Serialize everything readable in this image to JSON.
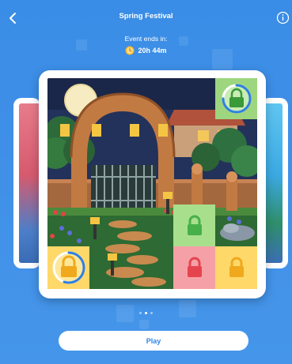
{
  "header": {
    "title": "Spring Festival",
    "back_icon": "chevron-left-icon",
    "info_icon": "info-icon"
  },
  "event": {
    "label": "Event ends in:",
    "time_left": "20h 44m",
    "clock_icon": "clock-icon"
  },
  "pager": {
    "pages": 3,
    "active_page": 2
  },
  "tiles": [
    {
      "name": "tile-top-right-locked",
      "state": "locked-in-progress",
      "color": "#9dd67e",
      "lock_color": "#3a9a3a",
      "progress": 0.75
    },
    {
      "name": "tile-green-locked",
      "state": "locked",
      "color": "#a8df8c",
      "lock_color": "#47b049"
    },
    {
      "name": "tile-bottom-left-locked",
      "state": "locked-in-progress",
      "color": "#ffd86a",
      "lock_color": "#f0a91c",
      "progress": 0.55
    },
    {
      "name": "tile-red-locked",
      "state": "locked",
      "color": "#f5a0a6",
      "lock_color": "#e5444f"
    },
    {
      "name": "tile-yellow-locked",
      "state": "locked",
      "color": "#ffd86a",
      "lock_color": "#f0a91c"
    }
  ],
  "actions": {
    "play_label": "Play"
  },
  "colors": {
    "background": "#3f8fe8",
    "accent": "#2f86e6",
    "progress_ring": "#2f7fe0"
  }
}
